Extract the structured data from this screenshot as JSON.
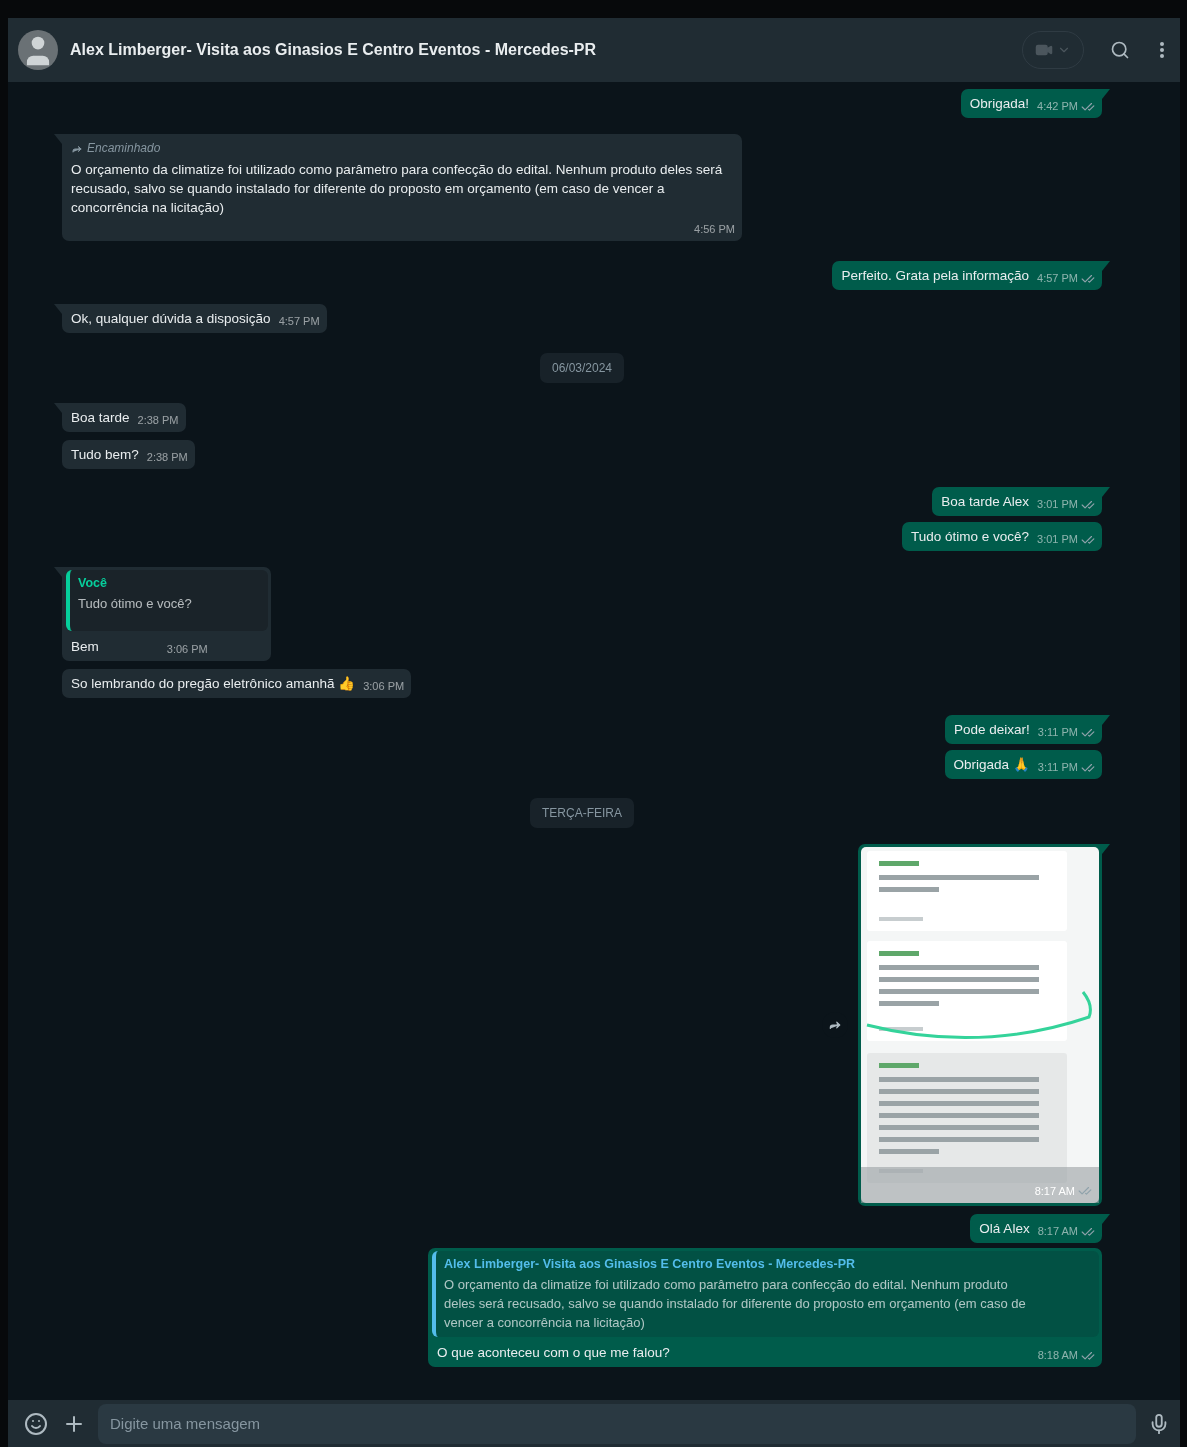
{
  "header": {
    "title": "Alex Limberger- Visita aos Ginasios E Centro Eventos - Mercedes-PR"
  },
  "messages": [
    {
      "kind": "out",
      "text": "Obrigada!",
      "time": "4:42 PM"
    },
    {
      "kind": "in",
      "forwarded": "Encaminhado",
      "text": "O orçamento da climatize foi utilizado como parâmetro para confecção do edital. Nenhum produto deles será recusado, salvo se quando instalado for diferente do proposto em orçamento (em caso de vencer a concorrência na licitação)",
      "time": "4:56 PM"
    },
    {
      "kind": "out",
      "text": "Perfeito. Grata pela informação",
      "time": "4:57 PM"
    },
    {
      "kind": "in",
      "text": "Ok, qualquer dúvida a disposição",
      "time": "4:57 PM"
    },
    {
      "kind": "date",
      "text": "06/03/2024"
    },
    {
      "kind": "in",
      "text": "Boa tarde",
      "time": "2:38 PM"
    },
    {
      "kind": "in",
      "text": "Tudo bem?",
      "time": "2:38 PM"
    },
    {
      "kind": "out",
      "text": "Boa tarde Alex",
      "time": "3:01 PM"
    },
    {
      "kind": "out",
      "text": "Tudo ótimo e você?",
      "time": "3:01 PM"
    },
    {
      "kind": "in",
      "quote": {
        "author": "Você",
        "text": "Tudo ótimo e você?"
      },
      "text": "Bem",
      "time": "3:06 PM"
    },
    {
      "kind": "in",
      "text": "So lembrando do pregão eletrônico amanhã 👍",
      "time": "3:06 PM"
    },
    {
      "kind": "out",
      "text": "Pode deixar!",
      "time": "3:11 PM"
    },
    {
      "kind": "out",
      "text": "Obrigada 🙏",
      "time": "3:11 PM"
    },
    {
      "kind": "date",
      "text": "TERÇA-FEIRA"
    },
    {
      "kind": "image",
      "time": "8:17 AM"
    },
    {
      "kind": "out",
      "text": "Olá Alex",
      "time": "8:17 AM"
    },
    {
      "kind": "out",
      "quote": {
        "author": "Alex Limberger- Visita aos Ginasios E Centro Eventos - Mercedes-PR",
        "text": "O orçamento da climatize foi utilizado como parâmetro para confecção do edital. Nenhum produto deles será recusado, salvo se quando instalado for diferente do proposto em orçamento (em caso de vencer a concorrência na licitação)"
      },
      "text": "O que aconteceu com o que me falou?",
      "time": "8:18 AM"
    }
  ],
  "composer": {
    "placeholder": "Digite uma mensagem"
  }
}
